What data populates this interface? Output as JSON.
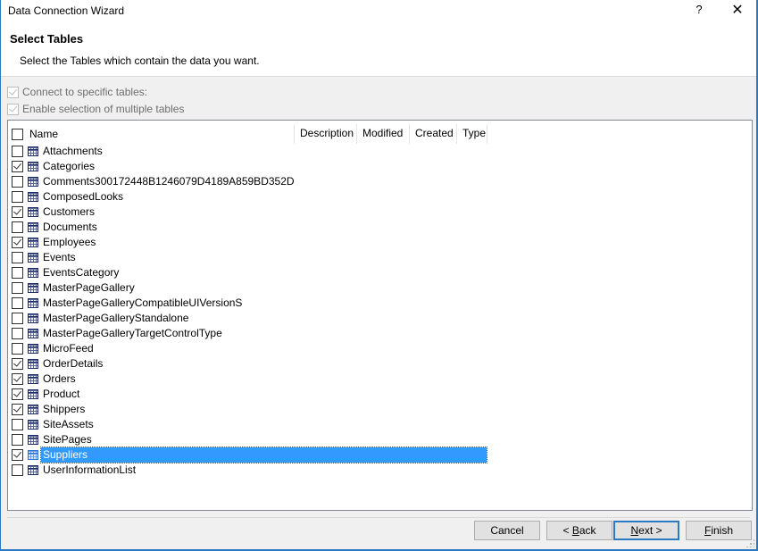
{
  "window": {
    "title": "Data Connection Wizard",
    "help_label": "?",
    "close_label": "✕"
  },
  "header": {
    "title": "Select Tables",
    "subtitle": "Select the Tables which contain the data you want."
  },
  "options": {
    "connect_specific": {
      "label": "Connect to specific tables:",
      "checked": true,
      "enabled": false
    },
    "enable_multiple": {
      "label": "Enable selection of multiple tables",
      "checked": true,
      "enabled": false
    }
  },
  "table_list": {
    "columns": [
      "Name",
      "Description",
      "Modified",
      "Created",
      "Type"
    ],
    "select_all_checked": false,
    "rows": [
      {
        "name": "Attachments",
        "checked": false
      },
      {
        "name": "Categories",
        "checked": true
      },
      {
        "name": "Comments300172448B1246079D4189A859BD352D",
        "checked": false
      },
      {
        "name": "ComposedLooks",
        "checked": false
      },
      {
        "name": "Customers",
        "checked": true
      },
      {
        "name": "Documents",
        "checked": false
      },
      {
        "name": "Employees",
        "checked": true
      },
      {
        "name": "Events",
        "checked": false
      },
      {
        "name": "EventsCategory",
        "checked": false
      },
      {
        "name": "MasterPageGallery",
        "checked": false
      },
      {
        "name": "MasterPageGalleryCompatibleUIVersionS",
        "checked": false
      },
      {
        "name": "MasterPageGalleryStandalone",
        "checked": false
      },
      {
        "name": "MasterPageGalleryTargetControlType",
        "checked": false
      },
      {
        "name": "MicroFeed",
        "checked": false
      },
      {
        "name": "OrderDetails",
        "checked": true
      },
      {
        "name": "Orders",
        "checked": true
      },
      {
        "name": "Product",
        "checked": true
      },
      {
        "name": "Shippers",
        "checked": true
      },
      {
        "name": "SiteAssets",
        "checked": false
      },
      {
        "name": "SitePages",
        "checked": false
      },
      {
        "name": "Suppliers",
        "checked": true,
        "selected": true
      },
      {
        "name": "UserInformationList",
        "checked": false
      }
    ],
    "icon": "table-icon"
  },
  "buttons": {
    "cancel": "Cancel",
    "back": "< Back",
    "next": "Next >",
    "finish": "Finish"
  },
  "colors": {
    "accent_border": "#2b79c2",
    "selection": "#3399ff"
  }
}
